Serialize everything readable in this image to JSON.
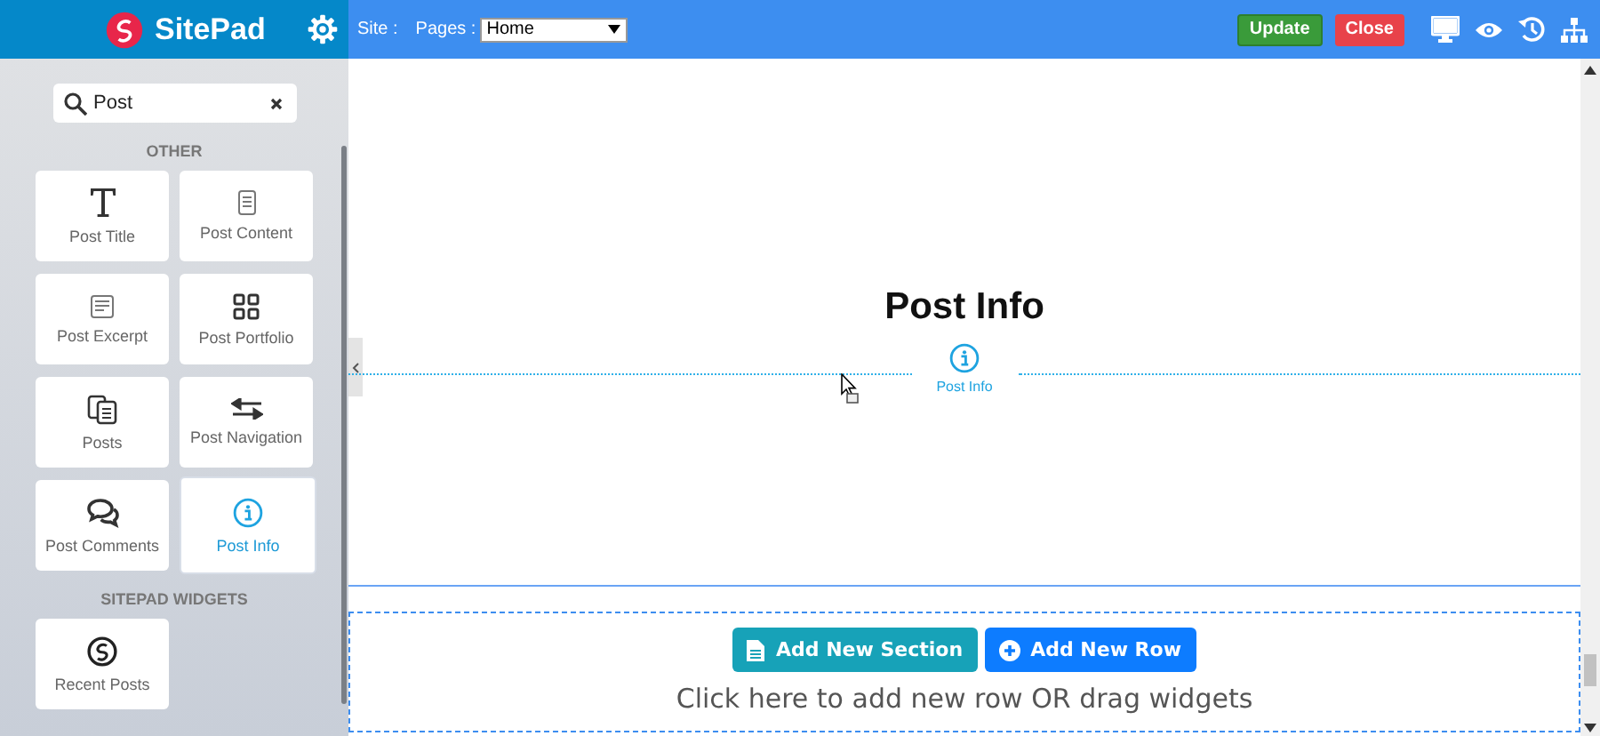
{
  "header": {
    "brand": "SitePad",
    "site_label": "Site :",
    "pages_label": "Pages :",
    "page_select": "Home",
    "buttons": [
      {
        "label": "Update",
        "kind": "update"
      },
      {
        "label": "Close",
        "kind": "close"
      }
    ]
  },
  "sidebar": {
    "search": {
      "value": "Post"
    },
    "groups": [
      {
        "title": "OTHER",
        "widgets": [
          {
            "label": "Post Title",
            "kind": "title",
            "selected": false
          },
          {
            "label": "Post Content",
            "kind": "content",
            "selected": false
          },
          {
            "label": "Post Excerpt",
            "kind": "excerpt",
            "selected": false
          },
          {
            "label": "Post Portfolio",
            "kind": "portfolio",
            "selected": false
          },
          {
            "label": "Posts",
            "kind": "posts",
            "selected": false
          },
          {
            "label": "Post Navigation",
            "kind": "navigation",
            "selected": false
          },
          {
            "label": "Post Comments",
            "kind": "comments",
            "selected": false
          },
          {
            "label": "Post Info",
            "kind": "info",
            "selected": true
          }
        ]
      },
      {
        "title": "SITEPAD WIDGETS",
        "widgets": [
          {
            "label": "Recent Posts",
            "kind": "recent",
            "selected": false
          }
        ]
      }
    ]
  },
  "canvas": {
    "heading": "Post Info",
    "drop_label": "Post Info",
    "add_section": "Add New Section",
    "add_row": "Add New Row",
    "hint": "Click here to add new row OR drag widgets"
  }
}
